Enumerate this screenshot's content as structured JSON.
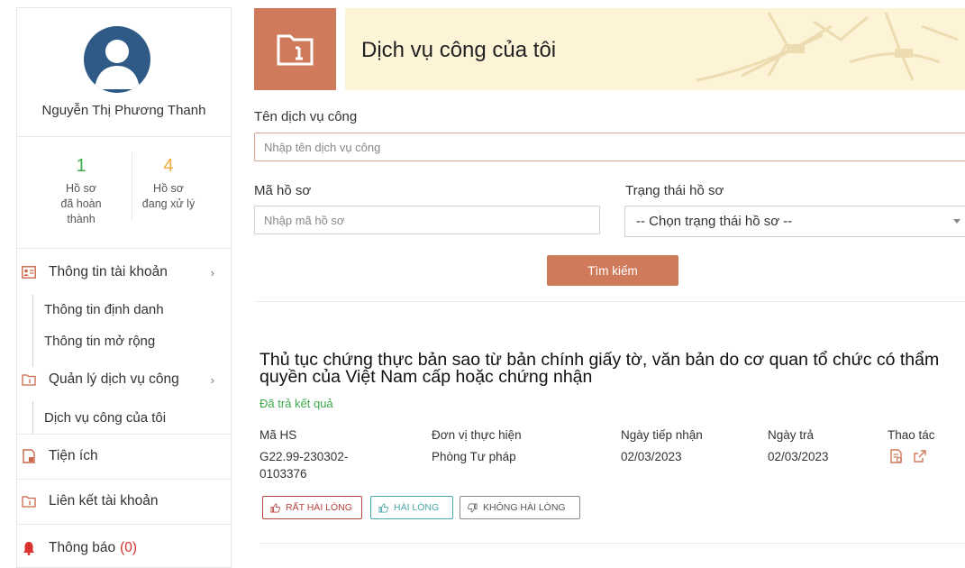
{
  "user": {
    "name": "Nguyễn Thị Phương Thanh",
    "completed_count": "1",
    "completed_label_1": "Hồ sơ",
    "completed_label_2": "đã hoàn thành",
    "processing_count": "4",
    "processing_label_1": "Hồ sơ",
    "processing_label_2": "đang xử lý"
  },
  "colors": {
    "accent": "#d07a5c",
    "completed": "#3daa4b",
    "processing": "#f0a93b",
    "banner_bg": "#fdf3d7"
  },
  "sidebar": {
    "account_info": "Thông tin tài khoản",
    "identity_info": "Thông tin định danh",
    "extended_info": "Thông tin mở rộng",
    "manage_services": "Quản lý dịch vụ công",
    "my_services": "Dịch vụ công của tôi",
    "utilities": "Tiện ích",
    "linked_accounts": "Liên kết tài khoản",
    "notifications": "Thông báo",
    "notification_count": "(0)"
  },
  "header": {
    "title": "Dịch vụ công của tôi"
  },
  "form": {
    "service_name_label": "Tên dịch vụ công",
    "service_name_placeholder": "Nhập tên dịch vụ công",
    "record_code_label": "Mã hồ sơ",
    "record_code_placeholder": "Nhập mã hồ sơ",
    "status_label": "Trạng thái hồ sơ",
    "status_selected": "-- Chọn trạng thái hồ sơ --",
    "search_button": "Tìm kiếm"
  },
  "result": {
    "title": "Thủ tục chứng thực bản sao từ bản chính giấy tờ, văn bản do cơ quan tổ chức có thẩm quyền của Việt Nam cấp hoặc chứng nhận",
    "status": "Đã trả kết quả",
    "columns": {
      "code": "Mã HS",
      "unit": "Đơn vị thực hiện",
      "received": "Ngày tiếp nhận",
      "returned": "Ngày trả",
      "actions": "Thao tác"
    },
    "values": {
      "code_line1": "G22.99-230302-",
      "code_line2": "0103376",
      "unit": "Phòng Tư pháp",
      "received": "02/03/2023",
      "returned": "02/03/2023"
    },
    "ratings": {
      "very_satisfied": "RẤT HÀI LÒNG",
      "satisfied": "HÀI LÒNG",
      "not_satisfied": "KHÔNG HÀI LÒNG"
    }
  }
}
